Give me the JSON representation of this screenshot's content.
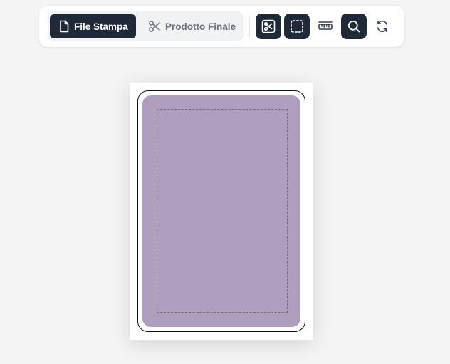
{
  "toolbar": {
    "modes": [
      {
        "label": "File Stampa",
        "icon": "file-icon",
        "active": true
      },
      {
        "label": "Prodotto Finale",
        "icon": "scissors-icon",
        "active": false
      }
    ],
    "tools": [
      {
        "icon": "cut-marks-icon",
        "active": true
      },
      {
        "icon": "safe-area-icon",
        "active": true
      },
      {
        "icon": "ruler-icon",
        "active": false
      },
      {
        "icon": "zoom-icon",
        "active": true
      },
      {
        "icon": "refresh-icon",
        "active": false
      }
    ]
  },
  "colors": {
    "card_fill": "#ae9fbf",
    "active_button": "#202938",
    "background": "#f4f4f4"
  }
}
